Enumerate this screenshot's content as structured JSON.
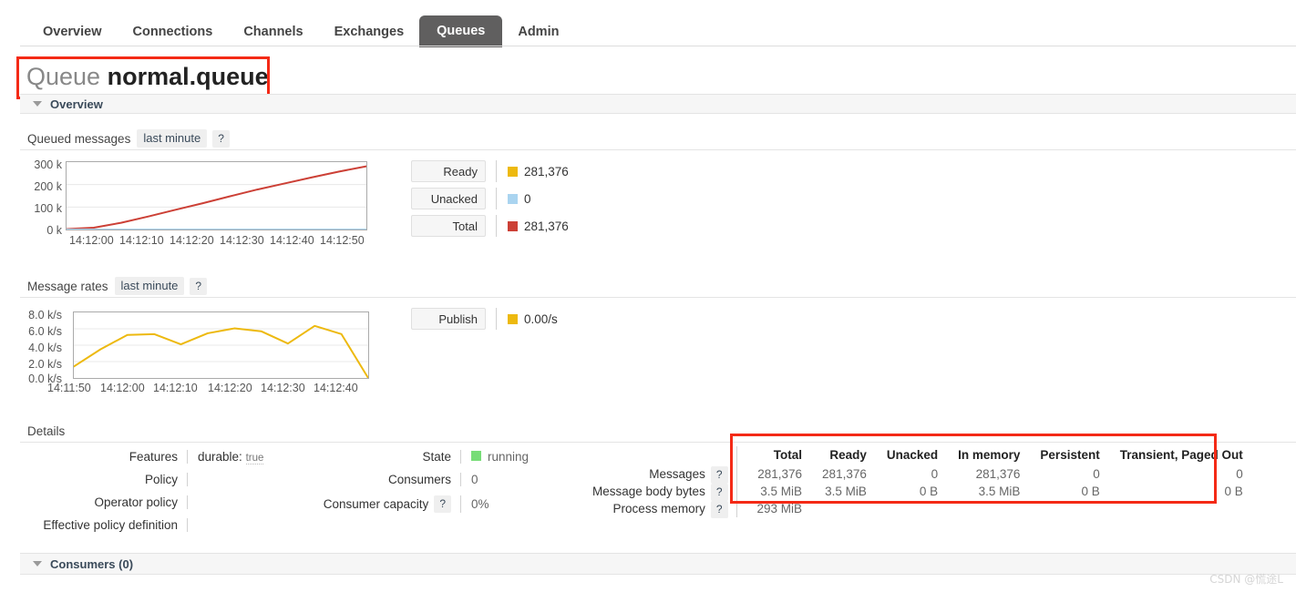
{
  "nav": {
    "tabs": [
      {
        "label": "Overview",
        "active": false
      },
      {
        "label": "Connections",
        "active": false
      },
      {
        "label": "Channels",
        "active": false
      },
      {
        "label": "Exchanges",
        "active": false
      },
      {
        "label": "Queues",
        "active": true
      },
      {
        "label": "Admin",
        "active": false
      }
    ]
  },
  "page": {
    "title_prefix": "Queue",
    "title_name": "normal.queue"
  },
  "sections": {
    "overview": "Overview",
    "consumers": "Consumers (0)",
    "details": "Details"
  },
  "queued_messages": {
    "label": "Queued messages",
    "period": "last minute",
    "help": "?",
    "legend": [
      {
        "name": "Ready",
        "value": "281,376",
        "color": "#edb90f"
      },
      {
        "name": "Unacked",
        "value": "0",
        "color": "#aad4f0"
      },
      {
        "name": "Total",
        "value": "281,376",
        "color": "#cc4036"
      }
    ]
  },
  "message_rates": {
    "label": "Message rates",
    "period": "last minute",
    "help": "?",
    "legend": [
      {
        "name": "Publish",
        "value": "0.00/s",
        "color": "#edb90f"
      }
    ]
  },
  "details": {
    "left": [
      {
        "key": "Features",
        "value": "durable:",
        "sub": "true"
      },
      {
        "key": "Policy",
        "value": "",
        "sub": ""
      },
      {
        "key": "Operator policy",
        "value": "",
        "sub": ""
      },
      {
        "key": "Effective policy definition",
        "value": "",
        "sub": ""
      }
    ],
    "middle": [
      {
        "key": "State",
        "value": "running",
        "dot": "#77dd77",
        "help": ""
      },
      {
        "key": "Consumers",
        "value": "0",
        "dot": "",
        "help": ""
      },
      {
        "key": "Consumer capacity",
        "value": "0%",
        "dot": "",
        "help": "?"
      }
    ]
  },
  "stats": {
    "columns": [
      "Total",
      "Ready",
      "Unacked",
      "In memory",
      "Persistent",
      "Transient, Paged Out"
    ],
    "rows": [
      {
        "label": "Messages",
        "help": "?",
        "cells": [
          "281,376",
          "281,376",
          "0",
          "281,376",
          "0",
          "0"
        ]
      },
      {
        "label": "Message body bytes",
        "help": "?",
        "cells": [
          "3.5 MiB",
          "3.5 MiB",
          "0 B",
          "3.5 MiB",
          "0 B",
          "0 B"
        ]
      },
      {
        "label": "Process memory",
        "help": "?",
        "cells": [
          "293 MiB",
          "",
          "",
          "",
          "",
          ""
        ]
      }
    ]
  },
  "watermark": "CSDN @慌途L",
  "chart_data": [
    {
      "type": "line",
      "title": "Queued messages",
      "xlabel": "",
      "ylabel": "",
      "ylim": [
        0,
        300000
      ],
      "yticks": [
        "0 k",
        "100 k",
        "200 k",
        "300 k"
      ],
      "ytick_values": [
        0,
        100000,
        200000,
        300000
      ],
      "xticks": [
        "14:12:00",
        "14:12:10",
        "14:12:20",
        "14:12:30",
        "14:12:40",
        "14:12:50"
      ],
      "grid": true,
      "legend_position": "right",
      "series": [
        {
          "name": "Total",
          "color": "#cc4036",
          "values": [
            2000,
            8000,
            30000,
            58000,
            88000,
            117000,
            148000,
            178000,
            205000,
            232000,
            258000,
            281376
          ]
        },
        {
          "name": "Unacked",
          "color": "#aad4f0",
          "values": [
            0,
            0,
            0,
            0,
            0,
            0,
            0,
            0,
            0,
            0,
            0,
            0
          ]
        }
      ]
    },
    {
      "type": "line",
      "title": "Message rates",
      "xlabel": "",
      "ylabel": "",
      "ylim": [
        0,
        8000
      ],
      "yticks": [
        "0.0 k/s",
        "2.0 k/s",
        "4.0 k/s",
        "6.0 k/s",
        "8.0 k/s"
      ],
      "ytick_values": [
        0,
        2000,
        4000,
        6000,
        8000
      ],
      "xticks": [
        "14:11:50",
        "14:12:00",
        "14:12:10",
        "14:12:20",
        "14:12:30",
        "14:12:40"
      ],
      "grid": true,
      "legend_position": "right",
      "series": [
        {
          "name": "Publish",
          "color": "#edb90f",
          "values": [
            1400,
            3500,
            5250,
            5350,
            4100,
            5450,
            6050,
            5700,
            4200,
            6350,
            5350,
            0
          ]
        }
      ]
    }
  ]
}
